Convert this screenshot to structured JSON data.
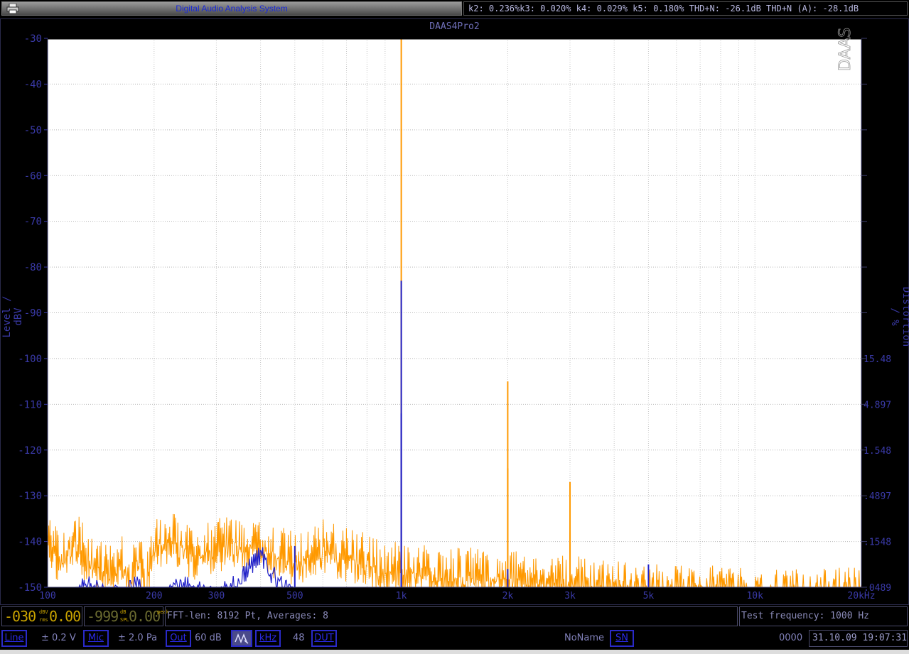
{
  "window": {
    "app_title": "Digital Audio Analysis System",
    "distortion_readout": "k2: 0.236%k3: 0.020% k4: 0.029% k5: 0.180% THD+N: -26.1dB THD+N (A): -28.1dB"
  },
  "chart_data": {
    "type": "line",
    "title": "DAAS4Pro2",
    "watermark": "DAAS",
    "xlabel": "",
    "ylabel": "Level / dBV",
    "y2label": "Distortion / %",
    "x_scale": "log",
    "xlim": [
      100,
      20000
    ],
    "ylim": [
      -150,
      -30
    ],
    "x_tick_values": [
      100,
      200,
      300,
      500,
      1000,
      2000,
      3000,
      5000,
      10000,
      20000
    ],
    "x_tick_labels": [
      "100",
      "200",
      "300",
      "500",
      "1k",
      "2k",
      "3k",
      "5k",
      "10k",
      "20kHz"
    ],
    "y_ticks": [
      -30,
      -40,
      -50,
      -60,
      -70,
      -80,
      -90,
      -100,
      -110,
      -120,
      -130,
      -140,
      -150
    ],
    "y2_tick_dbv": [
      -100,
      -110,
      -120,
      -130,
      -140,
      -150
    ],
    "y2_ticks": [
      "15.48",
      "4.897",
      "1.548",
      ".4897",
      ".1548",
      ".0489"
    ],
    "grid": true,
    "series": [
      {
        "color": "#ff9900",
        "peaks": [
          {
            "x": 1000,
            "y": -30
          },
          {
            "x": 2000,
            "y": -105
          },
          {
            "x": 2000,
            "y": -124
          },
          {
            "x": 3000,
            "y": -127
          },
          {
            "x": 3000,
            "y": -138
          }
        ],
        "noise_floor_x": [
          100,
          110,
          120,
          130,
          140,
          150,
          160,
          170,
          180,
          190,
          200,
          230,
          260,
          300,
          350,
          400,
          500,
          600,
          700,
          800,
          900,
          1100,
          1300,
          1500,
          2000,
          3000,
          4000,
          5000,
          7000,
          10000,
          15000,
          20000
        ],
        "noise_floor_y": [
          -134,
          -138,
          -133,
          -138,
          -140,
          -140,
          -137,
          -143,
          -137,
          -143,
          -134,
          -134,
          -137,
          -135,
          -134,
          -135,
          -138,
          -135,
          -137,
          -138,
          -140,
          -140,
          -142,
          -141,
          -142,
          -143,
          -144,
          -145,
          -145,
          -146,
          -146,
          -145
        ]
      },
      {
        "color": "#2020c8",
        "peaks": [
          {
            "x": 1000,
            "y": -83
          },
          {
            "x": 1000,
            "y": -112
          },
          {
            "x": 500,
            "y": -141
          },
          {
            "x": 2000,
            "y": -146
          },
          {
            "x": 5000,
            "y": -145
          }
        ],
        "noise_floor_x": [
          120,
          130,
          140,
          150,
          160,
          180,
          190,
          200,
          250,
          300,
          350,
          400,
          450,
          500
        ],
        "noise_floor_y": [
          -150,
          -146,
          -149,
          -150,
          -149,
          -147,
          -150,
          -150,
          -147,
          -150,
          -146,
          -140,
          -147,
          -150
        ]
      }
    ]
  },
  "status_bar_1": {
    "level_display": "-030",
    "level_unit_top": "dBV",
    "level_unit_bottom": "rms",
    "level_decimal": "0.00",
    "spl_display": "-999",
    "spl_unit_top": "dB",
    "spl_unit_bottom": "SPL",
    "spl_decimal": "0.00",
    "spl_unit_side": "peak",
    "fft_info": "FFT-len: 8192 Pt, Averages: 8",
    "test_frequency": "Test frequency: 1000 Hz"
  },
  "status_bar_2": {
    "line_button": "Line",
    "line_range": "± 0.2 V",
    "mic_button": "Mic",
    "mic_range": "± 2.0 Pa",
    "out_button": "Out",
    "out_level": "60 dB",
    "khz_button": "kHz",
    "sample_rate": "48",
    "dut_button": "DUT",
    "dut_name": "NoName",
    "sn_button": "SN",
    "serial": "0000",
    "datetime": "31.10.09 19:07:31"
  },
  "colors": {
    "orange_trace": "#ff9900",
    "blue_trace": "#2020c8",
    "axis_text": "#3a3aa8",
    "plot_bg": "#ffffff"
  }
}
